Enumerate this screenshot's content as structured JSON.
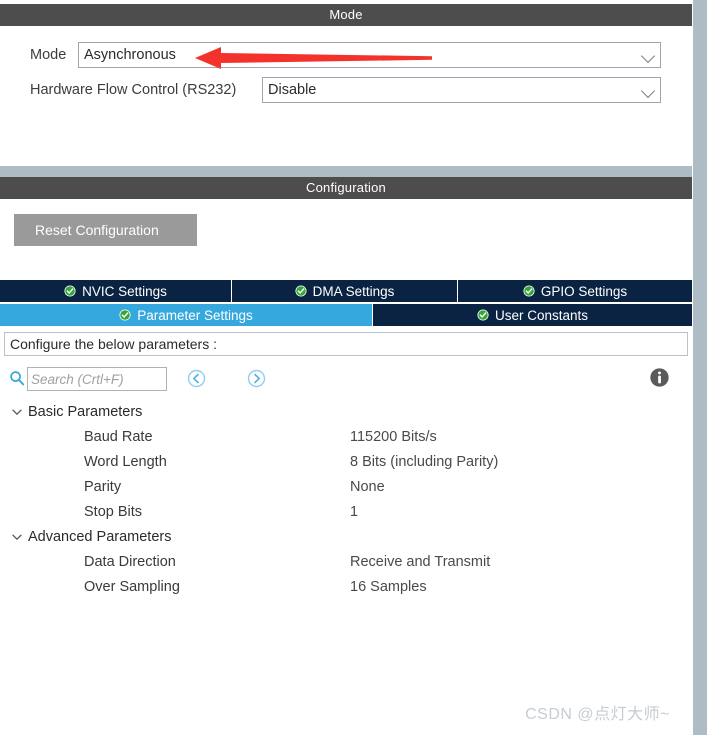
{
  "mode_panel": {
    "title": "Mode",
    "fields": [
      {
        "label": "Mode",
        "value": "Asynchronous",
        "icon": "chevron-down-icon"
      },
      {
        "label": "Hardware Flow Control (RS232)",
        "value": "Disable",
        "icon": "chevron-down-icon"
      }
    ],
    "annotation": {
      "type": "red-arrow",
      "direction": "left",
      "color": "#f3322c"
    }
  },
  "config_panel": {
    "title": "Configuration",
    "reset_button": "Reset Configuration",
    "tabs_row1": [
      {
        "label": "NVIC Settings",
        "active": false,
        "icon": "check-circle-icon"
      },
      {
        "label": "DMA Settings",
        "active": false,
        "icon": "check-circle-icon"
      },
      {
        "label": "GPIO Settings",
        "active": false,
        "icon": "check-circle-icon"
      }
    ],
    "tabs_row2": [
      {
        "label": "Parameter Settings",
        "active": true,
        "icon": "check-circle-icon"
      },
      {
        "label": "User Constants",
        "active": false,
        "icon": "check-circle-icon"
      }
    ],
    "hint": "Configure the below parameters :",
    "search": {
      "placeholder": "Search (Crtl+F)",
      "value": "",
      "icon": "search-icon",
      "prev_icon": "circle-left-arrow-icon",
      "next_icon": "circle-right-arrow-icon",
      "info_icon": "info-icon"
    },
    "groups": [
      {
        "label": "Basic Parameters",
        "expanded": true,
        "rows": [
          {
            "name": "Baud Rate",
            "value": "115200 Bits/s"
          },
          {
            "name": "Word Length",
            "value": "8 Bits (including Parity)"
          },
          {
            "name": "Parity",
            "value": "None"
          },
          {
            "name": "Stop Bits",
            "value": "1"
          }
        ]
      },
      {
        "label": "Advanced Parameters",
        "expanded": true,
        "rows": [
          {
            "name": "Data Direction",
            "value": "Receive and Transmit"
          },
          {
            "name": "Over Sampling",
            "value": "16 Samples"
          }
        ]
      }
    ]
  },
  "watermark": "CSDN @点灯大师~",
  "colors": {
    "panel_header": "#4d4d4d",
    "tab_inactive": "#0a2343",
    "tab_active": "#35a8dd",
    "chrome": "#aebcc6",
    "accent_red": "#f3322c",
    "check_green": "#36a63b"
  }
}
